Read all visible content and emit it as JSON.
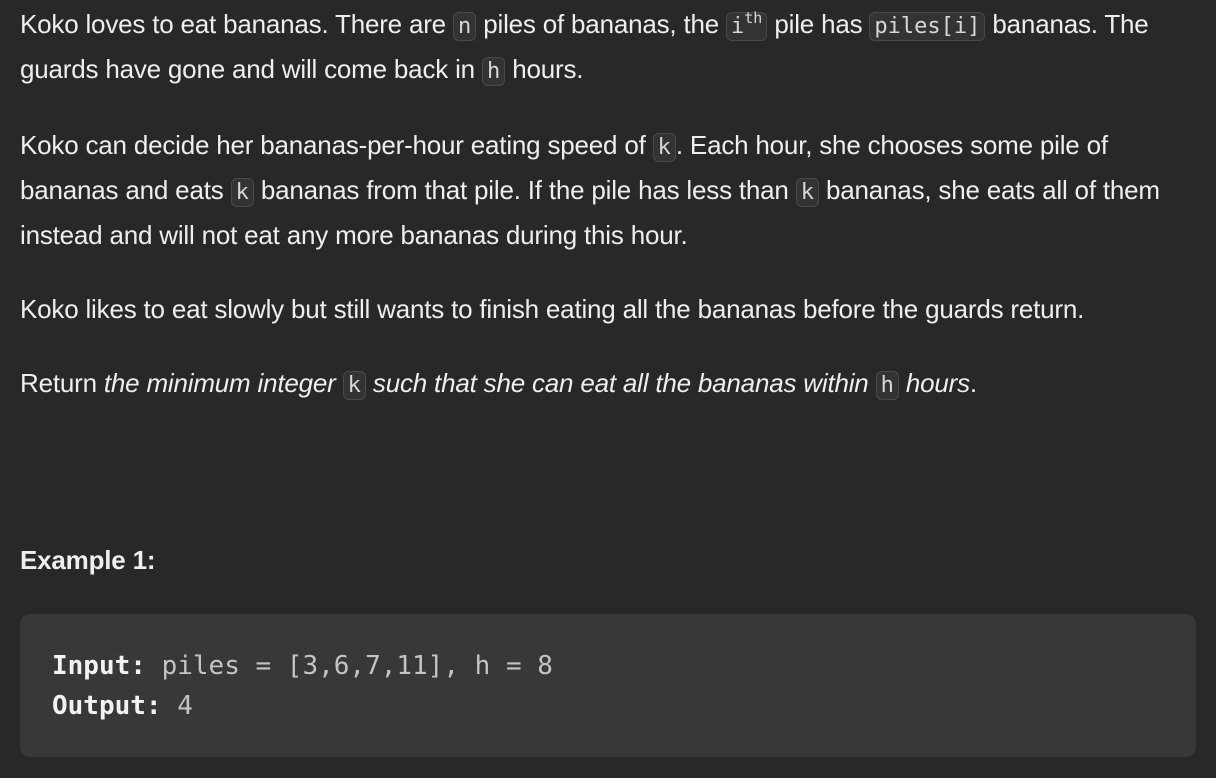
{
  "problem": {
    "p1": {
      "t1": "Koko loves to eat bananas. There are ",
      "c1": "n",
      "t2": " piles of bananas, the ",
      "c2_base": "i",
      "c2_sup": "th",
      "t3": " pile has ",
      "c3": "piles[i]",
      "t4": " bananas. The guards have gone and will come back in ",
      "c4": "h",
      "t5": " hours."
    },
    "p2": {
      "t1": "Koko can decide her bananas-per-hour eating speed of ",
      "c1": "k",
      "t2": ". Each hour, she chooses some pile of bananas and eats ",
      "c2": "k",
      "t3": " bananas from that pile. If the pile has less than ",
      "c3": "k",
      "t4": " bananas, she eats all of them instead and will not eat any more bananas during this hour."
    },
    "p3": {
      "t1": "Koko likes to eat slowly but still wants to finish eating all the bananas before the guards return."
    },
    "p4": {
      "t1": "Return ",
      "em1": "the minimum integer ",
      "c1": "k",
      "em2": " such that she can eat all the bananas within ",
      "c2": "h",
      "em3": " hours",
      "t2": "."
    }
  },
  "example1": {
    "heading": "Example 1:",
    "input_label": "Input:",
    "input_value": " piles = [3,6,7,11], h = 8",
    "output_label": "Output:",
    "output_value": " 4"
  }
}
